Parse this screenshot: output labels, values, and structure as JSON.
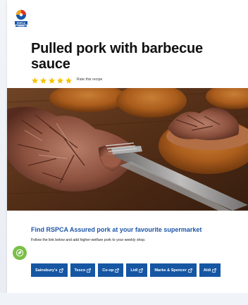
{
  "brand": {
    "name": "RSPCA ASSURED",
    "colors": {
      "blue": "#1656a3",
      "red": "#e6322b",
      "orange": "#f1a11d"
    }
  },
  "recipe": {
    "title": "Pulled pork with barbecue sauce",
    "rating": {
      "stars": 5,
      "label": "Rate this recipe",
      "star_color": "#f5c400"
    }
  },
  "find": {
    "title": "Find RSPCA Assured pork at your favourite supermarket",
    "subtitle": "Follow the link below and add higher-welfare pork to your weekly shop.",
    "stores": [
      {
        "label": "Sainsbury's",
        "icon": "external-link-icon"
      },
      {
        "label": "Tesco",
        "icon": "external-link-icon"
      },
      {
        "label": "Co-op",
        "icon": "external-link-icon"
      },
      {
        "label": "Lidl",
        "icon": "external-link-icon"
      },
      {
        "label": "Marks & Spencer",
        "icon": "external-link-icon"
      },
      {
        "label": "Aldi",
        "icon": "external-link-icon"
      }
    ]
  },
  "floating_button": {
    "icon": "eco-icon",
    "color": "#79bf48"
  }
}
